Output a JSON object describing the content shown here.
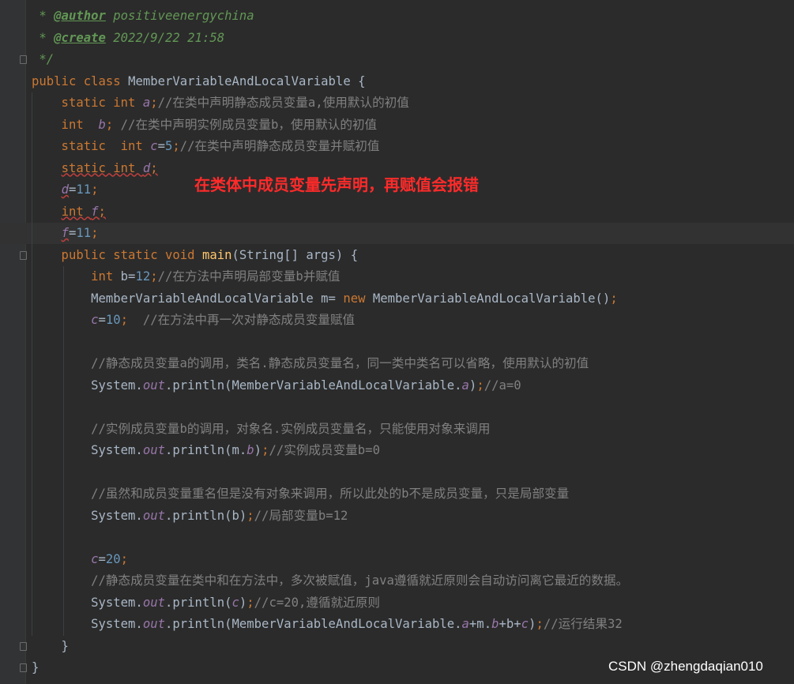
{
  "lines": [
    [
      {
        "t": " * ",
        "c": "c-doc"
      },
      {
        "t": "@author",
        "c": "c-tag"
      },
      {
        "t": " positiveenergychina",
        "c": "c-doc"
      }
    ],
    [
      {
        "t": " * ",
        "c": "c-doc"
      },
      {
        "t": "@create",
        "c": "c-tag"
      },
      {
        "t": " 2022/9/22 21:58",
        "c": "c-doc"
      }
    ],
    [
      {
        "t": " */",
        "c": "c-doc"
      }
    ],
    [
      {
        "t": "public class ",
        "c": "c-kw"
      },
      {
        "t": "MemberVariableAndLocalVariable {",
        "c": "c-id"
      }
    ],
    [
      {
        "t": "    static int ",
        "c": "c-kw"
      },
      {
        "t": "a",
        "c": "c-field"
      },
      {
        "t": ";",
        "c": "c-kw"
      },
      {
        "t": "//在类中声明静态成员变量a,使用默认的初值",
        "c": "c-cmt"
      }
    ],
    [
      {
        "t": "    int  ",
        "c": "c-kw"
      },
      {
        "t": "b",
        "c": "c-field"
      },
      {
        "t": "; ",
        "c": "c-kw"
      },
      {
        "t": "//在类中声明实例成员变量b，使用默认的初值",
        "c": "c-cmt"
      }
    ],
    [
      {
        "t": "    static  int ",
        "c": "c-kw"
      },
      {
        "t": "c",
        "c": "c-field"
      },
      {
        "t": "=",
        "c": "c-id"
      },
      {
        "t": "5",
        "c": "c-num"
      },
      {
        "t": ";",
        "c": "c-kw"
      },
      {
        "t": "//在类中声明静态成员变量并赋初值",
        "c": "c-cmt"
      }
    ],
    [
      {
        "t": "    ",
        "c": "c-kw"
      },
      {
        "t": "static int ",
        "c": "c-kw err"
      },
      {
        "t": "d",
        "c": "c-field err"
      },
      {
        "t": ";",
        "c": "c-kw err"
      }
    ],
    [
      {
        "t": "    ",
        "c": "c-kw"
      },
      {
        "t": "d",
        "c": "c-field err"
      },
      {
        "t": "=",
        "c": "c-id"
      },
      {
        "t": "11",
        "c": "c-num"
      },
      {
        "t": ";",
        "c": "c-kw"
      }
    ],
    [
      {
        "t": "    ",
        "c": "c-kw"
      },
      {
        "t": "int ",
        "c": "c-kw err"
      },
      {
        "t": "f",
        "c": "c-field err"
      },
      {
        "t": ";",
        "c": "c-kw err"
      }
    ],
    [
      {
        "t": "    ",
        "c": "c-kw"
      },
      {
        "t": "f",
        "c": "c-field err"
      },
      {
        "t": "=",
        "c": "c-id"
      },
      {
        "t": "11",
        "c": "c-num"
      },
      {
        "t": ";",
        "c": "c-kw"
      }
    ],
    [
      {
        "t": "    public static void ",
        "c": "c-kw"
      },
      {
        "t": "main",
        "c": "c-fn"
      },
      {
        "t": "(String[] args) {",
        "c": "c-id"
      }
    ],
    [
      {
        "t": "        int ",
        "c": "c-kw"
      },
      {
        "t": "b=",
        "c": "c-id"
      },
      {
        "t": "12",
        "c": "c-num"
      },
      {
        "t": ";",
        "c": "c-kw"
      },
      {
        "t": "//在方法中声明局部变量b并赋值",
        "c": "c-cmt"
      }
    ],
    [
      {
        "t": "        MemberVariableAndLocalVariable m= ",
        "c": "c-id"
      },
      {
        "t": "new ",
        "c": "c-kw"
      },
      {
        "t": "MemberVariableAndLocalVariable()",
        "c": "c-id"
      },
      {
        "t": ";",
        "c": "c-kw"
      }
    ],
    [
      {
        "t": "        ",
        "c": "c-id"
      },
      {
        "t": "c",
        "c": "c-field"
      },
      {
        "t": "=",
        "c": "c-id"
      },
      {
        "t": "10",
        "c": "c-num"
      },
      {
        "t": ";  ",
        "c": "c-kw"
      },
      {
        "t": "//在方法中再一次对静态成员变量赋值",
        "c": "c-cmt"
      }
    ],
    [],
    [
      {
        "t": "        //静态成员变量a的调用，类名.静态成员变量名，同一类中类名可以省略，使用默认的初值",
        "c": "c-cmt"
      }
    ],
    [
      {
        "t": "        System.",
        "c": "c-id"
      },
      {
        "t": "out",
        "c": "c-field"
      },
      {
        "t": ".println(MemberVariableAndLocalVariable.",
        "c": "c-id"
      },
      {
        "t": "a",
        "c": "c-field"
      },
      {
        "t": ")",
        "c": "c-id"
      },
      {
        "t": ";",
        "c": "c-kw"
      },
      {
        "t": "//a=0",
        "c": "c-cmt"
      }
    ],
    [],
    [
      {
        "t": "        //实例成员变量b的调用，对象名.实例成员变量名，只能使用对象来调用",
        "c": "c-cmt"
      }
    ],
    [
      {
        "t": "        System.",
        "c": "c-id"
      },
      {
        "t": "out",
        "c": "c-field"
      },
      {
        "t": ".println(m.",
        "c": "c-id"
      },
      {
        "t": "b",
        "c": "c-field"
      },
      {
        "t": ")",
        "c": "c-id"
      },
      {
        "t": ";",
        "c": "c-kw"
      },
      {
        "t": "//实例成员变量b=0",
        "c": "c-cmt"
      }
    ],
    [],
    [
      {
        "t": "        //虽然和成员变量重名但是没有对象来调用，所以此处的b不是成员变量，只是局部变量",
        "c": "c-cmt"
      }
    ],
    [
      {
        "t": "        System.",
        "c": "c-id"
      },
      {
        "t": "out",
        "c": "c-field"
      },
      {
        "t": ".println(b)",
        "c": "c-id"
      },
      {
        "t": ";",
        "c": "c-kw"
      },
      {
        "t": "//局部变量b=12",
        "c": "c-cmt"
      }
    ],
    [],
    [
      {
        "t": "        ",
        "c": "c-id"
      },
      {
        "t": "c",
        "c": "c-field"
      },
      {
        "t": "=",
        "c": "c-id"
      },
      {
        "t": "20",
        "c": "c-num"
      },
      {
        "t": ";",
        "c": "c-kw"
      }
    ],
    [
      {
        "t": "        //静态成员变量在类中和在方法中，多次被赋值，java遵循就近原则会自动访问离它最近的数据。",
        "c": "c-cmt"
      }
    ],
    [
      {
        "t": "        System.",
        "c": "c-id"
      },
      {
        "t": "out",
        "c": "c-field"
      },
      {
        "t": ".println(",
        "c": "c-id"
      },
      {
        "t": "c",
        "c": "c-field"
      },
      {
        "t": ")",
        "c": "c-id"
      },
      {
        "t": ";",
        "c": "c-kw"
      },
      {
        "t": "//c=20,遵循就近原则",
        "c": "c-cmt"
      }
    ],
    [
      {
        "t": "        System.",
        "c": "c-id"
      },
      {
        "t": "out",
        "c": "c-field"
      },
      {
        "t": ".println(MemberVariableAndLocalVariable.",
        "c": "c-id"
      },
      {
        "t": "a",
        "c": "c-field"
      },
      {
        "t": "+m.",
        "c": "c-id"
      },
      {
        "t": "b",
        "c": "c-field"
      },
      {
        "t": "+b+",
        "c": "c-id"
      },
      {
        "t": "c",
        "c": "c-field"
      },
      {
        "t": ")",
        "c": "c-id"
      },
      {
        "t": ";",
        "c": "c-kw"
      },
      {
        "t": "//运行结果32",
        "c": "c-cmt"
      }
    ],
    [
      {
        "t": "    }",
        "c": "c-id"
      }
    ],
    [
      {
        "t": "}",
        "c": "c-id"
      }
    ]
  ],
  "current_line_index": 10,
  "annotation": "在类体中成员变量先声明，再赋值会报错",
  "watermark": "CSDN @zhengdaqian010",
  "colors": {
    "background": "#2b2b2b",
    "keyword": "#cc7832",
    "comment": "#808080",
    "doc_comment": "#629755",
    "field": "#9876aa",
    "number": "#6897bb",
    "method": "#ffc66d",
    "annotation_red": "#ff2a2a"
  }
}
